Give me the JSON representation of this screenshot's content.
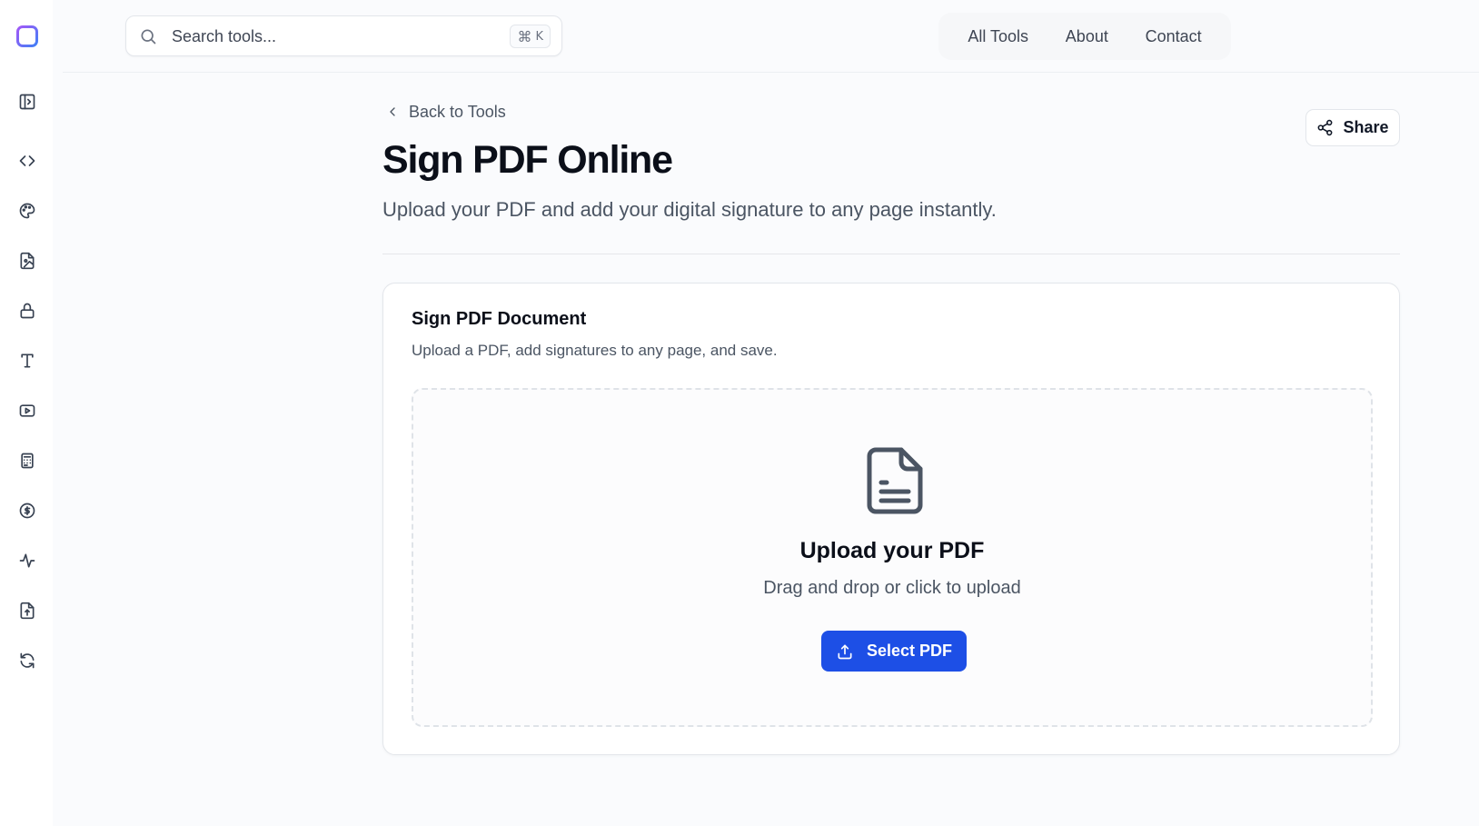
{
  "sidebar": {
    "logo": "app-logo",
    "items": [
      {
        "icon": "sidebar-toggle-icon"
      },
      {
        "icon": "code-icon"
      },
      {
        "icon": "palette-icon"
      },
      {
        "icon": "file-image-icon"
      },
      {
        "icon": "lock-icon"
      },
      {
        "icon": "type-icon"
      },
      {
        "icon": "video-icon"
      },
      {
        "icon": "calculator-icon"
      },
      {
        "icon": "dollar-icon"
      },
      {
        "icon": "activity-icon"
      },
      {
        "icon": "file-upload-icon"
      },
      {
        "icon": "refresh-icon"
      }
    ]
  },
  "header": {
    "search": {
      "placeholder": "Search tools...",
      "shortcut_symbol": "⌘",
      "shortcut_key": "K"
    },
    "nav": [
      "All Tools",
      "About",
      "Contact"
    ]
  },
  "page": {
    "back_label": "Back to Tools",
    "share_label": "Share",
    "title": "Sign PDF Online",
    "subtitle": "Upload your PDF and add your digital signature to any page instantly."
  },
  "card": {
    "title": "Sign PDF Document",
    "description": "Upload a PDF, add signatures to any page, and save.",
    "upload_title": "Upload your PDF",
    "upload_hint": "Drag and drop or click to upload",
    "button_label": "Select PDF"
  },
  "colors": {
    "primary": "#1d4fe6",
    "background": "#fafbfd",
    "text": "#0b0f19",
    "muted_text": "#4b5563"
  }
}
